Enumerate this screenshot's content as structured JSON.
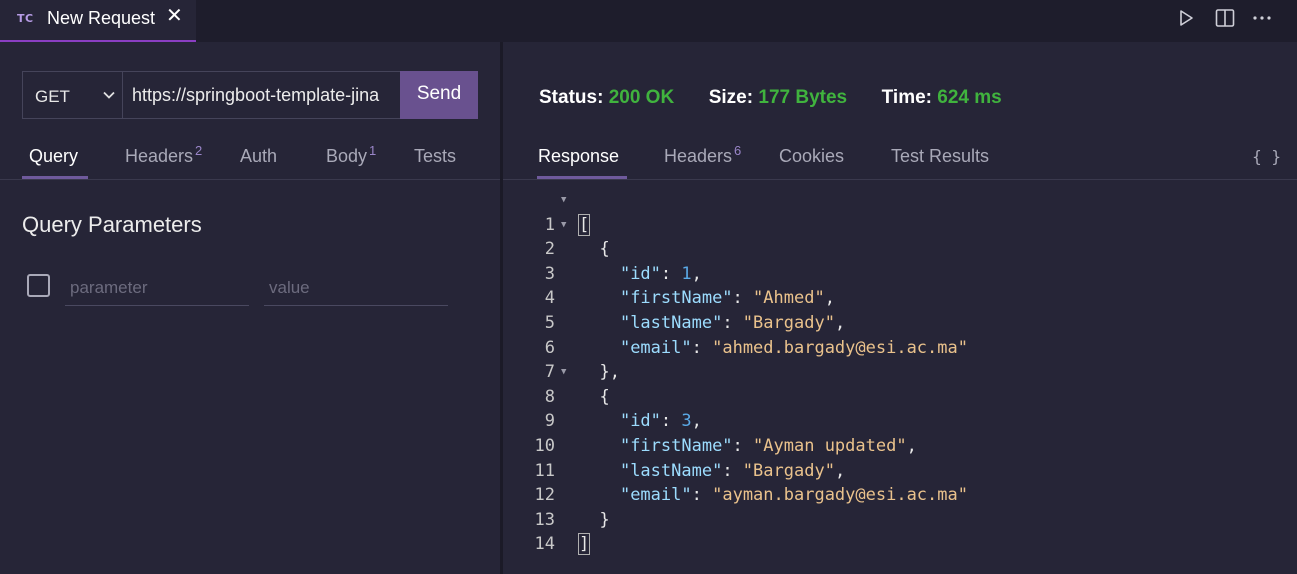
{
  "titlebar": {
    "tab_logo": "TC",
    "tab_title": "New Request",
    "tab_close": "✕",
    "icons": [
      "play-icon",
      "split-editor-icon",
      "more-icon"
    ]
  },
  "request": {
    "method": "GET",
    "url": "https://springboot-template-jina",
    "send_label": "Send",
    "tabs": [
      {
        "label": "Query",
        "badge": ""
      },
      {
        "label": "Headers",
        "badge": "2"
      },
      {
        "label": "Auth",
        "badge": ""
      },
      {
        "label": "Body",
        "badge": "1"
      },
      {
        "label": "Tests",
        "badge": ""
      }
    ],
    "active_tab": "Query"
  },
  "query_params": {
    "heading": "Query Parameters",
    "param_placeholder": "parameter",
    "value_placeholder": "value"
  },
  "response": {
    "status_label": "Status:",
    "status_value": "200 OK",
    "size_label": "Size:",
    "size_value": "177 Bytes",
    "time_label": "Time:",
    "time_value": "624 ms",
    "tabs": [
      {
        "label": "Response",
        "badge": ""
      },
      {
        "label": "Headers",
        "badge": "6"
      },
      {
        "label": "Cookies",
        "badge": ""
      },
      {
        "label": "Test Results",
        "badge": ""
      }
    ],
    "active_tab": "Response",
    "format_icon": "{ }",
    "body_lines": [
      "1",
      "2",
      "3",
      "4",
      "5",
      "6",
      "7",
      "8",
      "9",
      "10",
      "11",
      "12",
      "13",
      "14"
    ],
    "records": [
      {
        "id": "1",
        "firstName": "Ahmed",
        "lastName": "Bargady",
        "email": "ahmed.bargady@esi.ac.ma"
      },
      {
        "id": "3",
        "firstName": "Ayman updated",
        "lastName": "Bargady",
        "email": "ayman.bargady@esi.ac.ma"
      }
    ]
  },
  "colors": {
    "accent": "#69518f",
    "status_ok": "#40b33e",
    "json_key": "#9cdcfe",
    "json_string": "#eac28c",
    "json_number": "#5aa9e6"
  }
}
